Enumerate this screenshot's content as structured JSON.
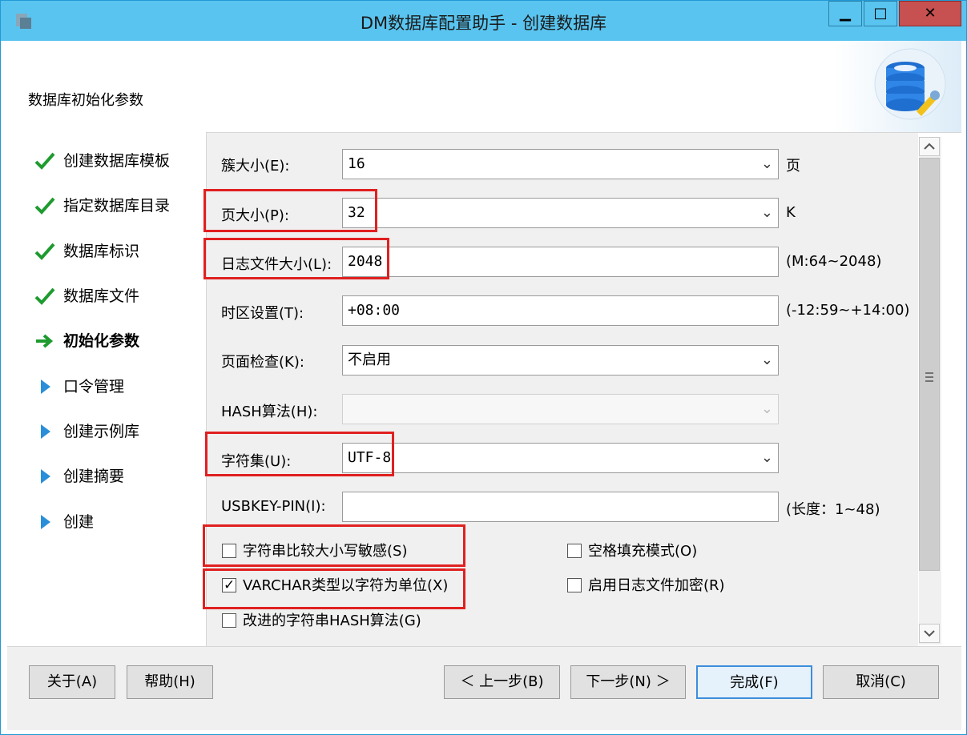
{
  "window": {
    "title": "DM数据库配置助手 - 创建数据库"
  },
  "header": {
    "title": "数据库初始化参数"
  },
  "steps": [
    {
      "label": "创建数据库模板",
      "state": "done"
    },
    {
      "label": "指定数据库目录",
      "state": "done"
    },
    {
      "label": "数据库标识",
      "state": "done"
    },
    {
      "label": "数据库文件",
      "state": "done"
    },
    {
      "label": "初始化参数",
      "state": "current"
    },
    {
      "label": "口令管理",
      "state": "pending"
    },
    {
      "label": "创建示例库",
      "state": "pending"
    },
    {
      "label": "创建摘要",
      "state": "pending"
    },
    {
      "label": "创建",
      "state": "pending"
    }
  ],
  "form": {
    "extent_size": {
      "label": "簇大小(E):",
      "value": "16",
      "unit": "页"
    },
    "page_size": {
      "label": "页大小(P):",
      "value": "32",
      "unit": "K"
    },
    "log_size": {
      "label": "日志文件大小(L):",
      "value": "2048",
      "unit": "(M:64~2048)"
    },
    "time_zone": {
      "label": "时区设置(T):",
      "value": "+08:00",
      "unit": "(-12:59~+14:00)"
    },
    "page_check": {
      "label": "页面检查(K):",
      "value": "不启用"
    },
    "hash_algo": {
      "label": "HASH算法(H):",
      "value": ""
    },
    "charset": {
      "label": "字符集(U):",
      "value": "UTF-8"
    },
    "usbkey_pin": {
      "label": "USBKEY-PIN(I):",
      "value": "",
      "unit": "(长度：1~48)"
    }
  },
  "checkboxes": {
    "case_sensitive": {
      "label": "字符串比较大小写敏感(S)",
      "checked": false
    },
    "blank_pad": {
      "label": "空格填充模式(O)",
      "checked": false
    },
    "varchar_char": {
      "label": "VARCHAR类型以字符为单位(X)",
      "checked": true
    },
    "log_encrypt": {
      "label": "启用日志文件加密(R)",
      "checked": false
    },
    "improved_hash": {
      "label": "改进的字符串HASH算法(G)",
      "checked": false
    }
  },
  "footer": {
    "about": "关于(A)",
    "help": "帮助(H)",
    "back": "＜ 上一步(B)",
    "next": "下一步(N) ＞",
    "finish": "完成(F)",
    "cancel": "取消(C)"
  },
  "colors": {
    "titlebar": "#59c4ef",
    "highlight": "#e02020",
    "check": "#1e9b2f",
    "arrow": "#2a8fd8"
  }
}
